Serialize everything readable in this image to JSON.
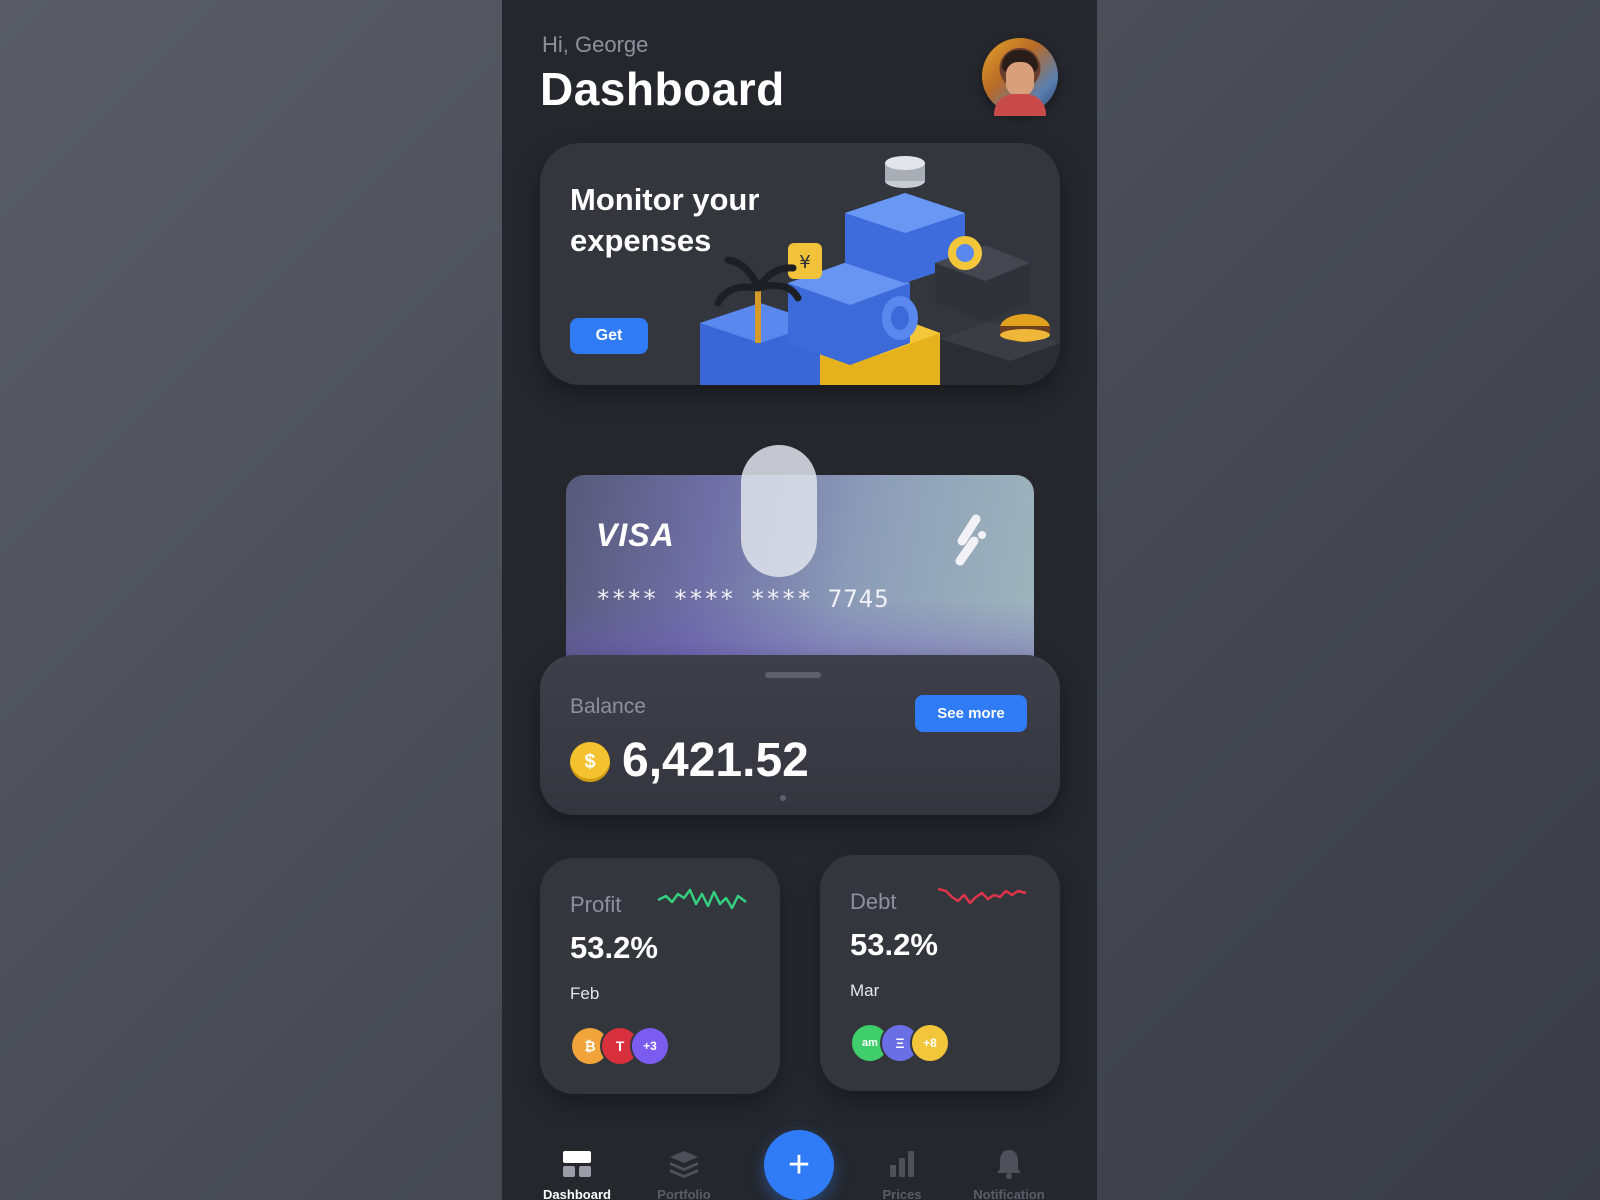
{
  "header": {
    "greeting": "Hi, George",
    "title": "Dashboard",
    "avatar_icon": "user-avatar"
  },
  "promo": {
    "text": "Monitor your expenses",
    "button_label": "Get",
    "illustration_icon": "finance-3d-illustration"
  },
  "card": {
    "brand": "VISA",
    "number": "**** **** **** 7745",
    "brand_icon": "card-network-icon"
  },
  "balance": {
    "label": "Balance",
    "currency_symbol": "$",
    "value": "6,421.52",
    "see_more_label": "See more"
  },
  "stats": [
    {
      "label": "Profit",
      "value": "53.2%",
      "month": "Feb",
      "trend_color": "#35d07f",
      "assets": [
        {
          "text": "₿",
          "color": "#f0a43a"
        },
        {
          "text": "T",
          "color": "#d8303c"
        },
        {
          "text": "+3",
          "color": "#7a5cf0"
        }
      ]
    },
    {
      "label": "Debt",
      "value": "53.2%",
      "month": "Mar",
      "trend_color": "#e0344b",
      "assets": [
        {
          "text": "am",
          "color": "#3fce6b"
        },
        {
          "text": "Ξ",
          "color": "#6a6fe6"
        },
        {
          "text": "+8",
          "color": "#f2c53a"
        }
      ]
    }
  ],
  "nav": {
    "items": [
      {
        "label": "Dashboard",
        "icon": "dashboard-icon",
        "active": true
      },
      {
        "label": "Portfolio",
        "icon": "layers-icon"
      },
      {
        "label": "Prices",
        "icon": "bar-chart-icon"
      },
      {
        "label": "Notification",
        "icon": "bell-icon"
      }
    ],
    "add_label": "+"
  },
  "colors": {
    "accent": "#2f7cf6",
    "panel": "#34363d",
    "background": "#25272d"
  }
}
